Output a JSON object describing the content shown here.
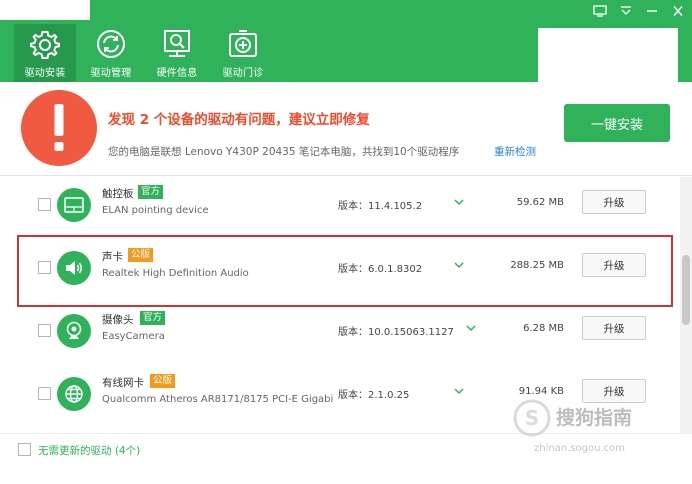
{
  "nav": {
    "items": [
      {
        "label": "驱动安装",
        "icon": "gear-icon"
      },
      {
        "label": "驱动管理",
        "icon": "refresh-icon"
      },
      {
        "label": "硬件信息",
        "icon": "search-monitor-icon"
      },
      {
        "label": "驱动门诊",
        "icon": "medical-kit-icon"
      }
    ],
    "active_index": 0
  },
  "alert": {
    "title": "发现 2 个设备的驱动有问题，建议立即修复",
    "subtitle": "您的电脑是联想 Lenovo Y430P 20435 笔记本电脑，共找到10个驱动程序",
    "rescan_link": "重新检测",
    "install_button": "一键安装"
  },
  "drivers": [
    {
      "name": "触控板",
      "badge": "官方",
      "badge_type": "official",
      "description": "ELAN pointing device",
      "version": "版本：11.4.105.2",
      "size": "59.62 MB",
      "action": "升级",
      "icon": "touchpad-icon"
    },
    {
      "name": "声卡",
      "badge": "公版",
      "badge_type": "public",
      "description": "Realtek High Definition Audio",
      "version": "版本：6.0.1.8302",
      "size": "288.25 MB",
      "action": "升级",
      "icon": "speaker-icon"
    },
    {
      "name": "摄像头",
      "badge": "官方",
      "badge_type": "official",
      "description": "EasyCamera",
      "version": "版本：10.0.15063.1127",
      "size": "6.28 MB",
      "action": "升级",
      "icon": "camera-icon"
    },
    {
      "name": "有线网卡",
      "badge": "公版",
      "badge_type": "public",
      "description": "Qualcomm Atheros AR8171/8175 PCI-E Gigabi",
      "version": "版本：2.1.0.25",
      "size": "91.94 KB",
      "action": "升级",
      "icon": "globe-icon"
    }
  ],
  "footer": {
    "no_update_label": "无需更新的驱动 (4个)"
  },
  "watermark": {
    "text": "搜狗指南",
    "url": "zhinan.sogou.com"
  },
  "colors": {
    "brand_green": "#2fb25a",
    "alert_red": "#f05a40",
    "badge_orange": "#f39a1e",
    "link_blue": "#2a84d6",
    "highlight_red": "#cc3333"
  }
}
